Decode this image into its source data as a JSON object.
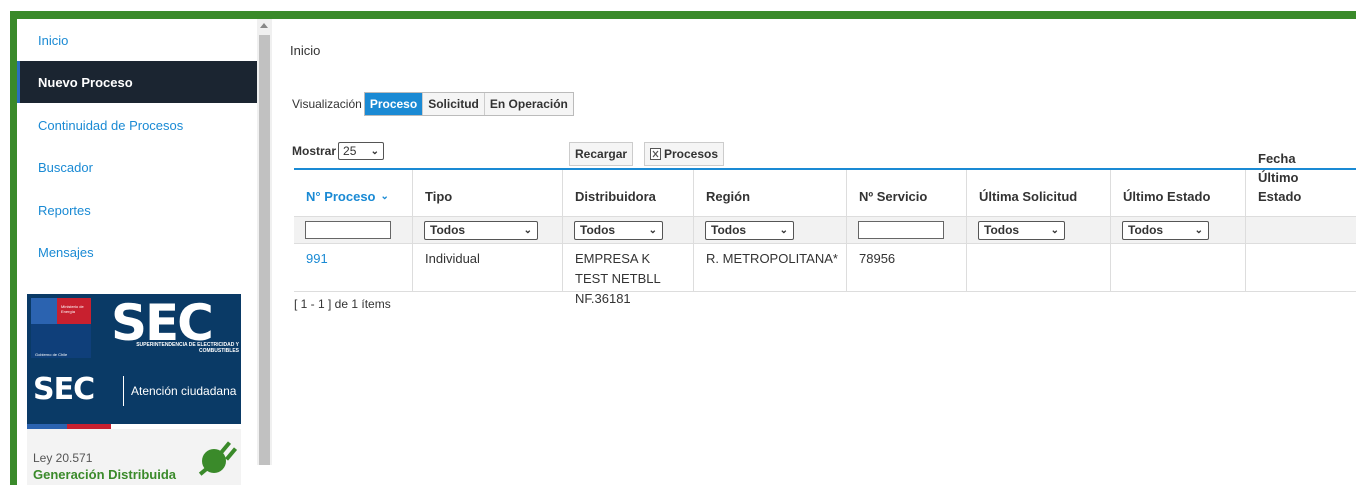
{
  "sidebar": {
    "items": [
      {
        "label": "Inicio"
      },
      {
        "label": "Nuevo Proceso"
      },
      {
        "label": "Continuidad de Procesos"
      },
      {
        "label": "Buscador"
      },
      {
        "label": "Reportes"
      },
      {
        "label": "Mensajes"
      }
    ],
    "banner_sec": {
      "gov_title": "Ministerio de Energía",
      "gov_footer": "Gobierno de Chile",
      "logo": "SEC",
      "subtitle": "SUPERINTENDENCIA DE ELECTRICIDAD Y COMBUSTIBLES",
      "atencion": "Atención ciudadana"
    },
    "banner_gd": {
      "ley": "Ley 20.571",
      "title": "Generación Distribuida"
    }
  },
  "main": {
    "breadcrumb": "Inicio",
    "visualizacion_label": "Visualización",
    "view_tabs": [
      "Proceso",
      "Solicitud",
      "En Operación"
    ],
    "mostrar_label": "Mostrar",
    "page_size": "25",
    "recargar": "Recargar",
    "procesos": "Procesos",
    "table": {
      "headers": [
        "N° Proceso",
        "Tipo",
        "Distribuidora",
        "Región",
        "Nº Servicio",
        "Última Solicitud",
        "Último Estado",
        "Fecha Último Estado"
      ],
      "filter_all": "Todos",
      "rows": [
        {
          "proceso": "991",
          "tipo": "Individual",
          "distribuidora": "EMPRESA K TEST NETBLL NF.36181",
          "region": "R. METROPOLITANA*",
          "servicio": "78956",
          "ultima_solicitud": "",
          "ultimo_estado": "",
          "fecha": ""
        }
      ]
    },
    "pager_text": "[ 1 - 1 ] de 1 ítems"
  },
  "colors": {
    "accent": "#1a8ad4",
    "frame": "#3a8a2a",
    "active_nav": "#1b2531"
  }
}
